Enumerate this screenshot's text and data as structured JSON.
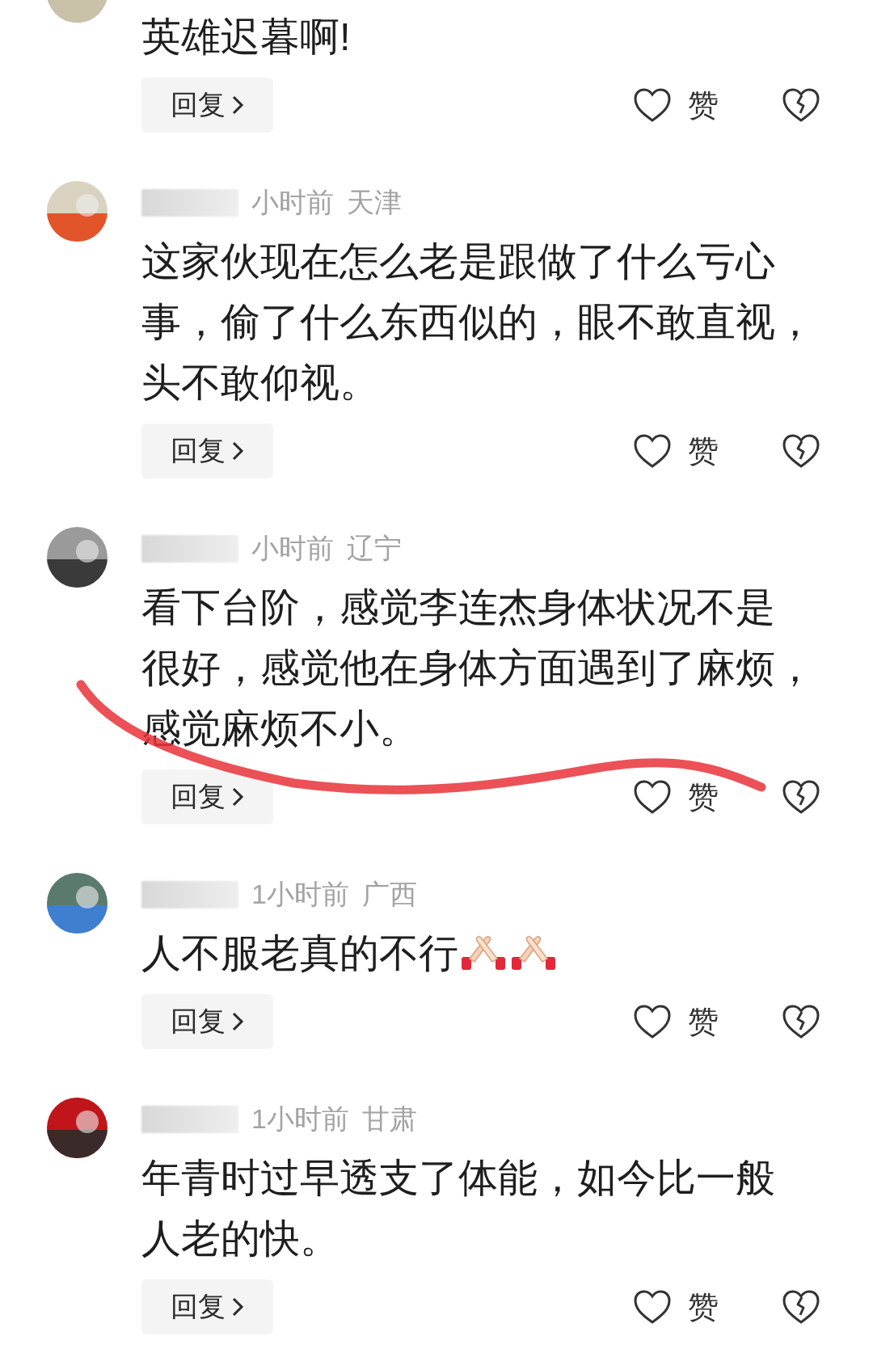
{
  "comments": [
    {
      "text_lines": [
        "英雄迟暮啊!"
      ],
      "reply_label": "回复",
      "like_label": "赞",
      "liked": false,
      "marked": false
    },
    {
      "time": "小时前",
      "location": "天津",
      "text_lines": [
        "这家伙现在怎么老是跟做了什么亏心",
        "事，偷了什么东西似的，眼不敢直视，",
        "头不敢仰视。"
      ],
      "reply_label": "回复",
      "like_label": "赞",
      "liked": false,
      "marked": false
    },
    {
      "time": "小时前",
      "location": "辽宁",
      "text_lines": [
        "看下台阶，感觉李连杰身体状况不是",
        "很好，感觉他在身体方面遇到了麻烦，",
        "感觉麻烦不小。"
      ],
      "reply_label": "回复",
      "like_label": "赞",
      "liked": false,
      "marked": true
    },
    {
      "time": "1小时前",
      "location": "广西",
      "text_lines": [
        "人不服老真的不行"
      ],
      "emojis": [
        {
          "kind": "clap"
        },
        {
          "kind": "clap"
        }
      ],
      "reply_label": "回复",
      "like_label": "赞",
      "liked": false,
      "marked": false
    },
    {
      "time": "1小时前",
      "location": "甘肃",
      "text_lines": [
        "年青时过早透支了体能，如今比一般",
        "人老的快。"
      ],
      "reply_label": "回复",
      "like_label": "赞",
      "liked": false,
      "marked": false
    }
  ]
}
